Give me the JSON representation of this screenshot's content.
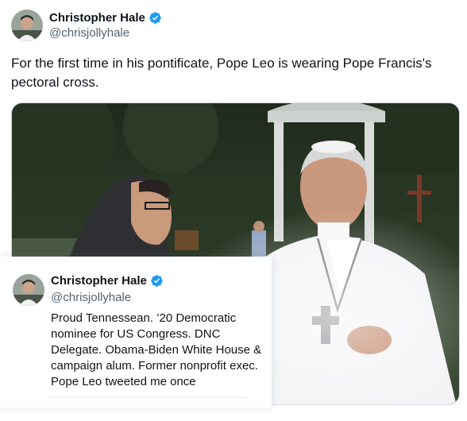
{
  "tweet": {
    "author": {
      "display_name": "Christopher Hale",
      "handle": "@chrisjollyhale",
      "verified_icon": "verified-badge-icon",
      "verified_color": "#1d9bf0"
    },
    "text": "For the first time in his pontificate, Pope Leo is wearing Pope Francis's pectoral cross.",
    "media": {
      "type": "photo"
    }
  },
  "hovercard": {
    "display_name": "Christopher Hale",
    "handle": "@chrisjollyhale",
    "bio": "Proud Tennessean. ’20 Democratic nominee for US Congress. DNC Delegate. Obama-Biden White House & campaign alum. Former nonprofit exec. Pope Leo tweeted me once"
  },
  "colors": {
    "text_primary": "#0f1419",
    "text_secondary": "#536471",
    "accent": "#1d9bf0"
  }
}
